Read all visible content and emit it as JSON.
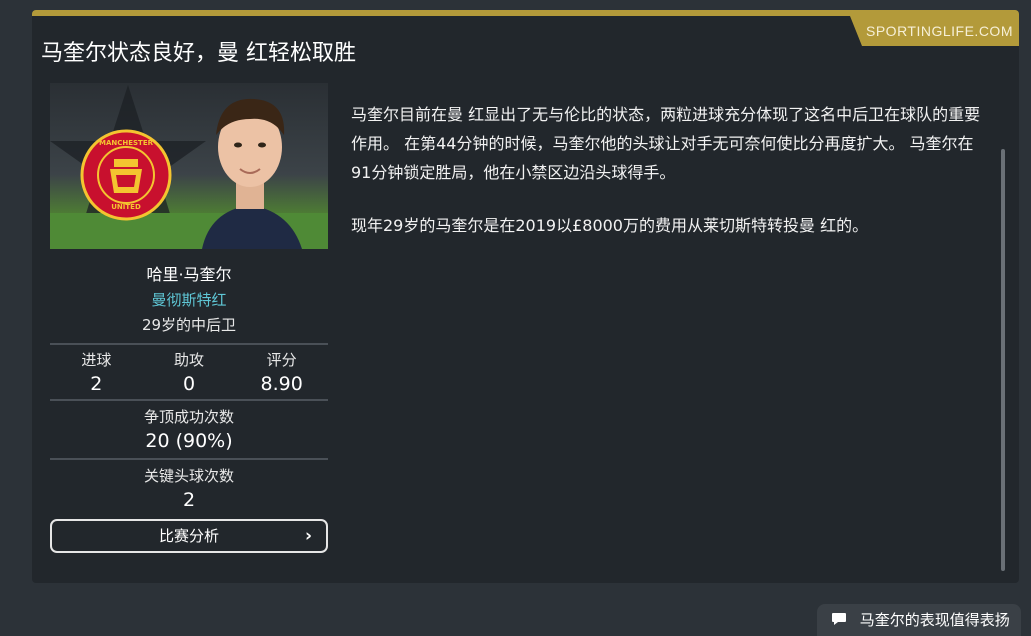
{
  "card": {
    "source": "SPORTINGLIFE.COM",
    "headline": "马奎尔状态良好，曼 红轻松取胜"
  },
  "player": {
    "name": "哈里·马奎尔",
    "club": "曼彻斯特红",
    "description": "29岁的中后卫",
    "club_badge_text": [
      "MANCHESTER",
      "UNITED"
    ],
    "stats": [
      {
        "label": "进球",
        "value": "2"
      },
      {
        "label": "助攻",
        "value": "0"
      },
      {
        "label": "评分",
        "value": "8.90"
      }
    ],
    "headers_won": {
      "label": "争顶成功次数",
      "value": "20 (90%)"
    },
    "key_headers": {
      "label": "关键头球次数",
      "value": "2"
    },
    "analysis_button": "比赛分析"
  },
  "article": {
    "paragraphs": [
      "马奎尔目前在曼 红显出了无与伦比的状态，两粒进球充分体现了这名中后卫在球队的重要作用。 在第44分钟的时候，马奎尔他的头球让对手无可奈何使比分再度扩大。 马奎尔在91分钟锁定胜局，他在小禁区边沿头球得手。",
      "现年29岁的马奎尔是在2019以£8000万的费用从莱切斯特转投曼 红的。"
    ]
  },
  "footer": {
    "button_label": "马奎尔的表现值得表扬",
    "icon": "speech-bubble-icon"
  },
  "colors": {
    "accent_gold": "#b39a3a",
    "link_cyan": "#5fc7d6",
    "card_bg": "#22272c",
    "page_bg": "#2c3238"
  }
}
